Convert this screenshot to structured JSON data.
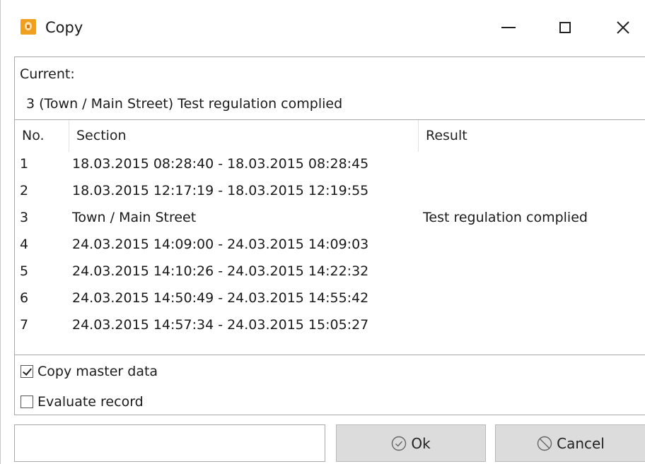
{
  "window": {
    "title": "Copy"
  },
  "current": {
    "label": "Current:",
    "value": "3 (Town / Main Street) Test regulation complied"
  },
  "table": {
    "columns": [
      "No.",
      "Section",
      "Result"
    ],
    "rows": [
      {
        "no": "1",
        "section": "18.03.2015 08:28:40 - 18.03.2015 08:28:45",
        "result": ""
      },
      {
        "no": "2",
        "section": "18.03.2015 12:17:19 - 18.03.2015 12:19:55",
        "result": ""
      },
      {
        "no": "3",
        "section": "Town / Main Street",
        "result": "Test regulation complied"
      },
      {
        "no": "4",
        "section": "24.03.2015 14:09:00 - 24.03.2015 14:09:03",
        "result": ""
      },
      {
        "no": "5",
        "section": "24.03.2015 14:10:26 - 24.03.2015 14:22:32",
        "result": ""
      },
      {
        "no": "6",
        "section": "24.03.2015 14:50:49 - 24.03.2015 14:55:42",
        "result": ""
      },
      {
        "no": "7",
        "section": "24.03.2015 14:57:34 - 24.03.2015 15:05:27",
        "result": ""
      }
    ]
  },
  "options": {
    "copy_master_data": {
      "label": "Copy master data",
      "checked": true
    },
    "evaluate_record": {
      "label": "Evaluate record",
      "checked": false
    }
  },
  "footer": {
    "status_text": "",
    "ok_label": "Ok",
    "cancel_label": "Cancel"
  },
  "icons": {
    "app": "app-logo-icon",
    "ok": "check-circle-icon",
    "cancel": "prohibited-icon"
  },
  "colors": {
    "app_icon": "#f0a020",
    "button_bg": "#dcdcdc",
    "border": "#a8a8a8"
  }
}
